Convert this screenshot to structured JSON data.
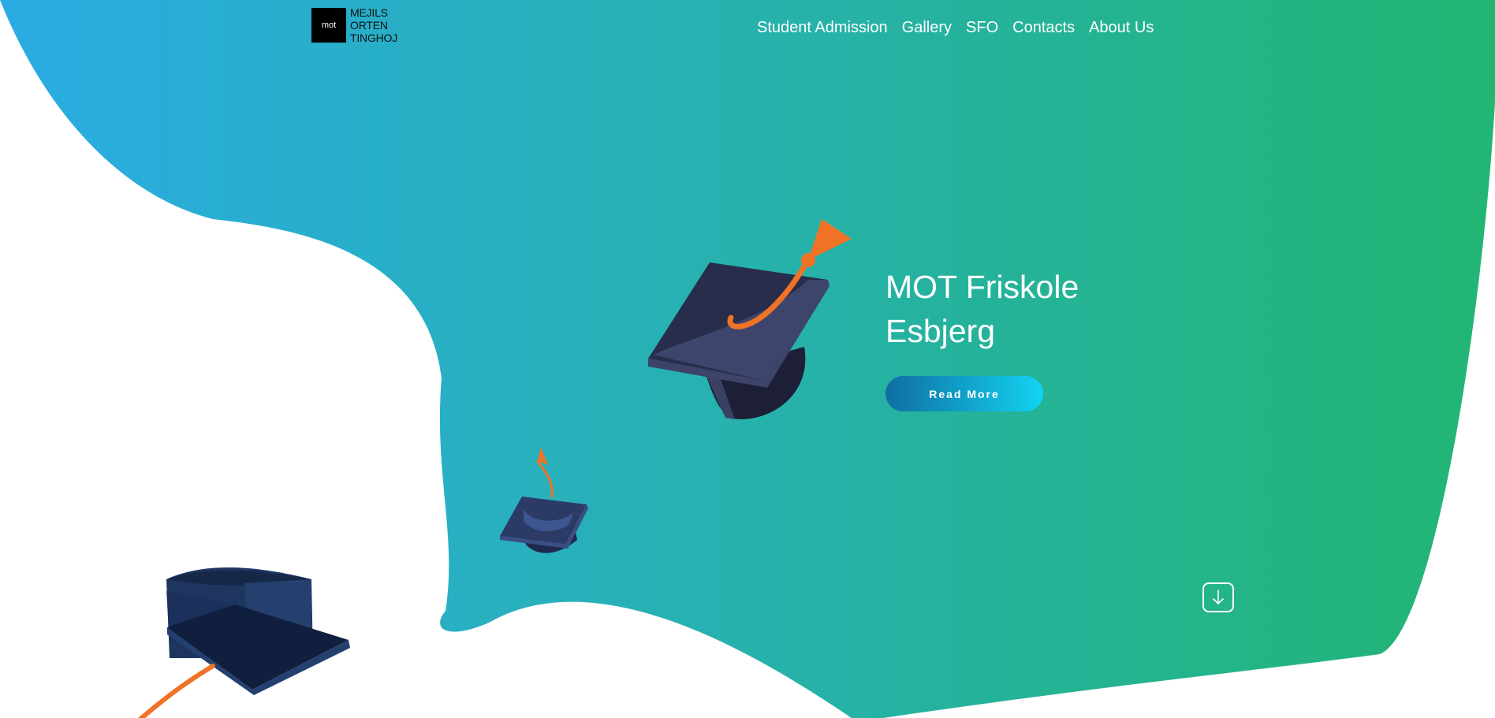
{
  "brand": {
    "logo_mark": "mot",
    "logo_line1": "MEJILS",
    "logo_line2": "ORTEN",
    "logo_line3": "TINGHOJ"
  },
  "nav": {
    "items": [
      {
        "label": "Student Admission"
      },
      {
        "label": "Gallery"
      },
      {
        "label": "SFO"
      },
      {
        "label": "Contacts"
      },
      {
        "label": "About Us"
      }
    ]
  },
  "hero": {
    "title_line1": "MOT Friskole",
    "title_line2": "Esbjerg",
    "cta_label": "Read More"
  },
  "colors": {
    "gradient_start": "#2aace3",
    "gradient_end": "#22b573",
    "cap_dark": "#2a2f4a",
    "tassel": "#f07226"
  },
  "icons": {
    "scroll": "arrow-down-icon"
  }
}
